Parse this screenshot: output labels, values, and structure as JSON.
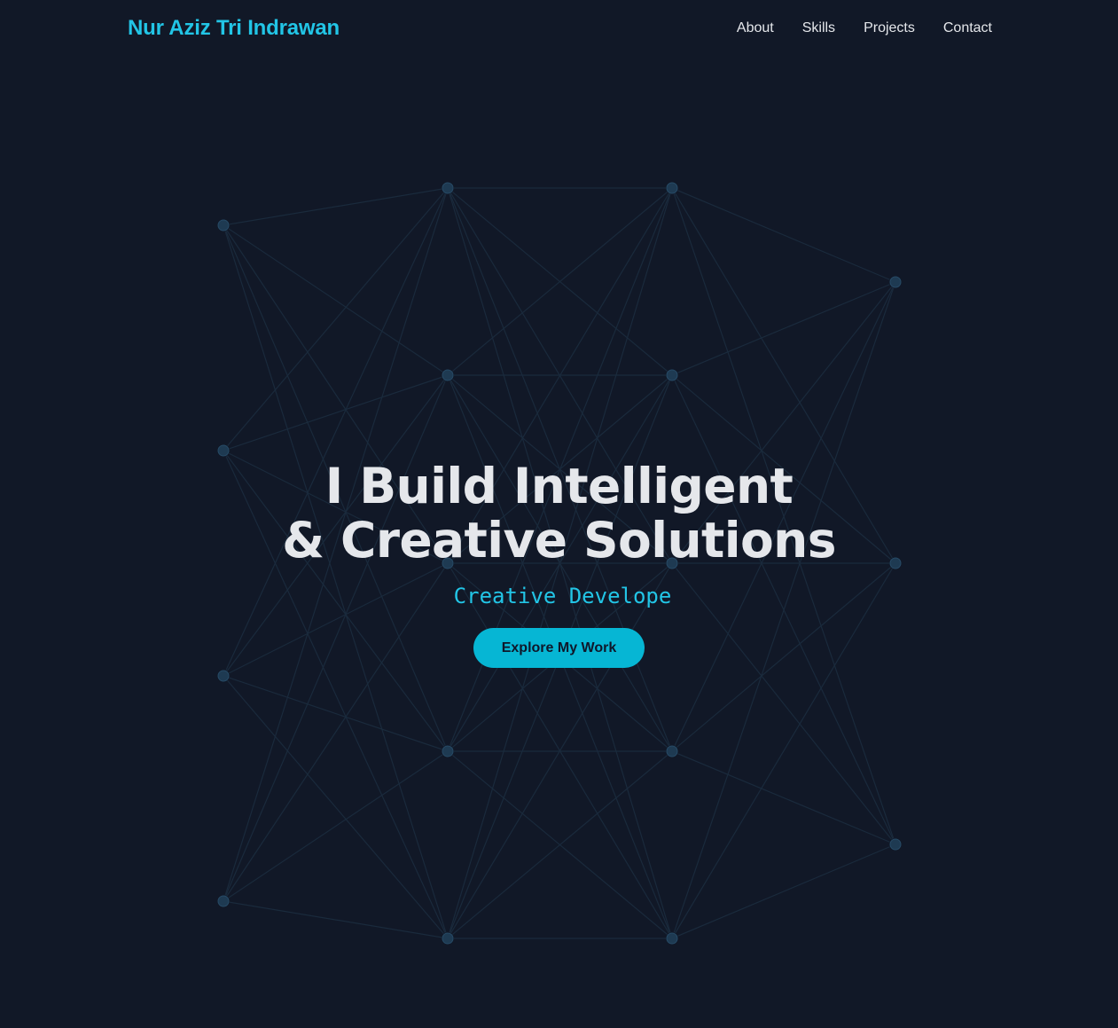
{
  "header": {
    "brand": "Nur Aziz Tri Indrawan",
    "nav": [
      "About",
      "Skills",
      "Projects",
      "Contact"
    ]
  },
  "hero": {
    "headline_line1": "I Build Intelligent",
    "headline_line2": "& Creative Solutions",
    "tagline": "Creative Develope",
    "cta_label": "Explore My Work"
  },
  "colors": {
    "background": "#111827",
    "accent": "#22c5e6",
    "button": "#06b6d4",
    "text": "#e5e7eb",
    "node": "#1e3a52"
  }
}
